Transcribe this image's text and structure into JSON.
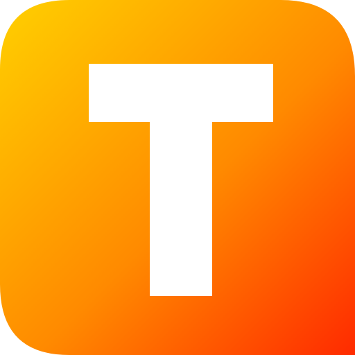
{
  "app_icon": {
    "icon_name": "letter-t-app-icon",
    "letter": "T",
    "colors": {
      "gradient_start": "#ffd000",
      "gradient_mid": "#ff8a00",
      "gradient_end": "#ff2a00",
      "glyph": "#ffffff",
      "background": "#ffffff"
    }
  }
}
